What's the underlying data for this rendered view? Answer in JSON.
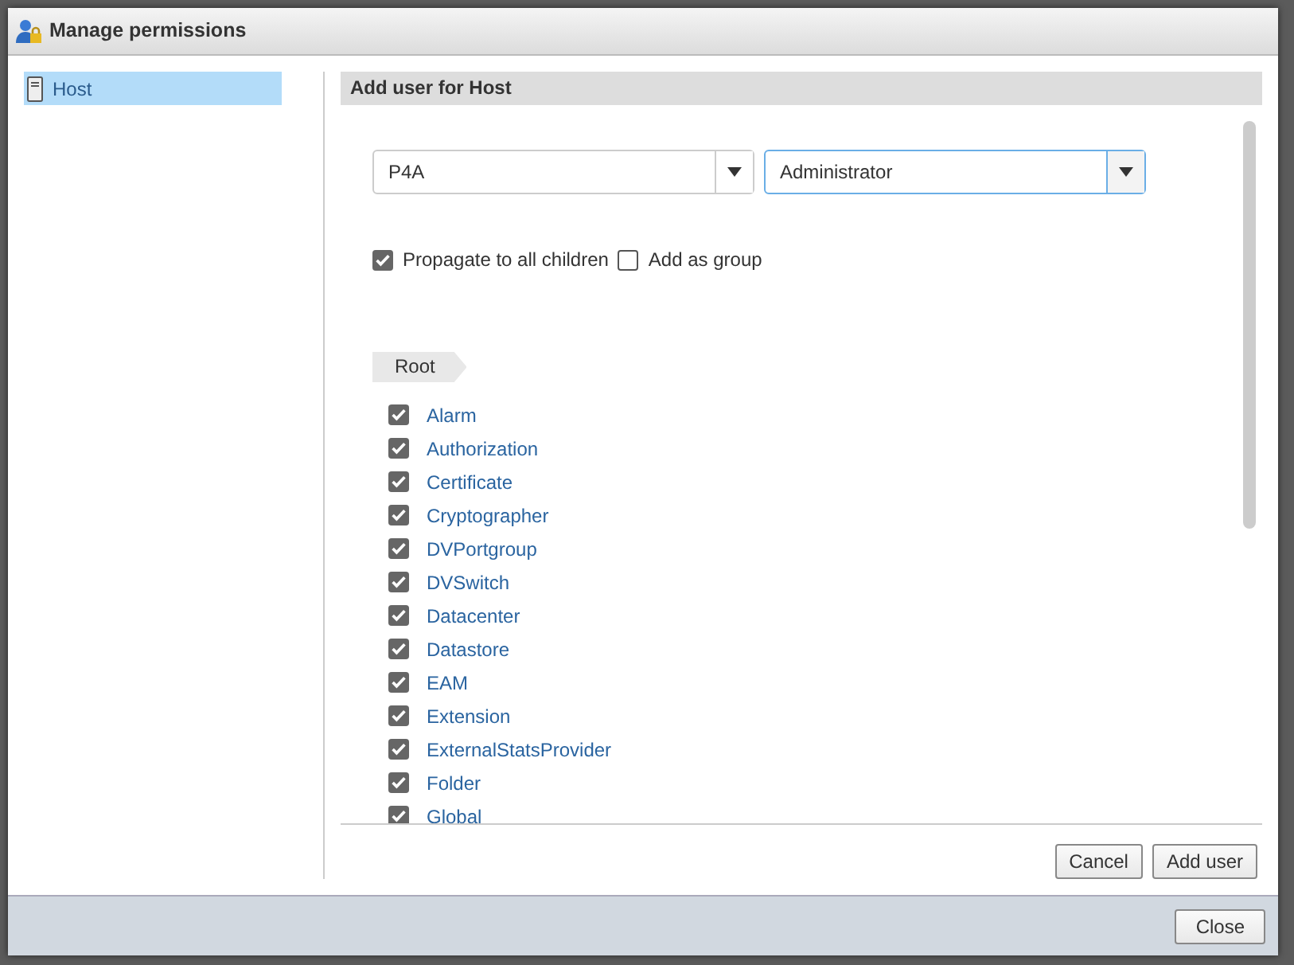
{
  "dialog": {
    "title": "Manage permissions"
  },
  "sidebar": {
    "items": [
      {
        "label": "Host",
        "selected": true
      }
    ]
  },
  "panel": {
    "title": "Add user for Host",
    "user_combo": {
      "value": "P4A",
      "focused": false
    },
    "role_combo": {
      "value": "Administrator",
      "focused": true
    },
    "options": [
      {
        "label": "Propagate to all children",
        "checked": true
      },
      {
        "label": "Add as group",
        "checked": false
      }
    ],
    "breadcrumb": "Root",
    "privileges": [
      {
        "label": "Alarm",
        "checked": true
      },
      {
        "label": "Authorization",
        "checked": true
      },
      {
        "label": "Certificate",
        "checked": true
      },
      {
        "label": "Cryptographer",
        "checked": true
      },
      {
        "label": "DVPortgroup",
        "checked": true
      },
      {
        "label": "DVSwitch",
        "checked": true
      },
      {
        "label": "Datacenter",
        "checked": true
      },
      {
        "label": "Datastore",
        "checked": true
      },
      {
        "label": "EAM",
        "checked": true
      },
      {
        "label": "Extension",
        "checked": true
      },
      {
        "label": "ExternalStatsProvider",
        "checked": true
      },
      {
        "label": "Folder",
        "checked": true
      },
      {
        "label": "Global",
        "checked": true
      }
    ],
    "buttons": [
      "Cancel",
      "Add user"
    ]
  },
  "footer": {
    "buttons": [
      "Close"
    ]
  }
}
